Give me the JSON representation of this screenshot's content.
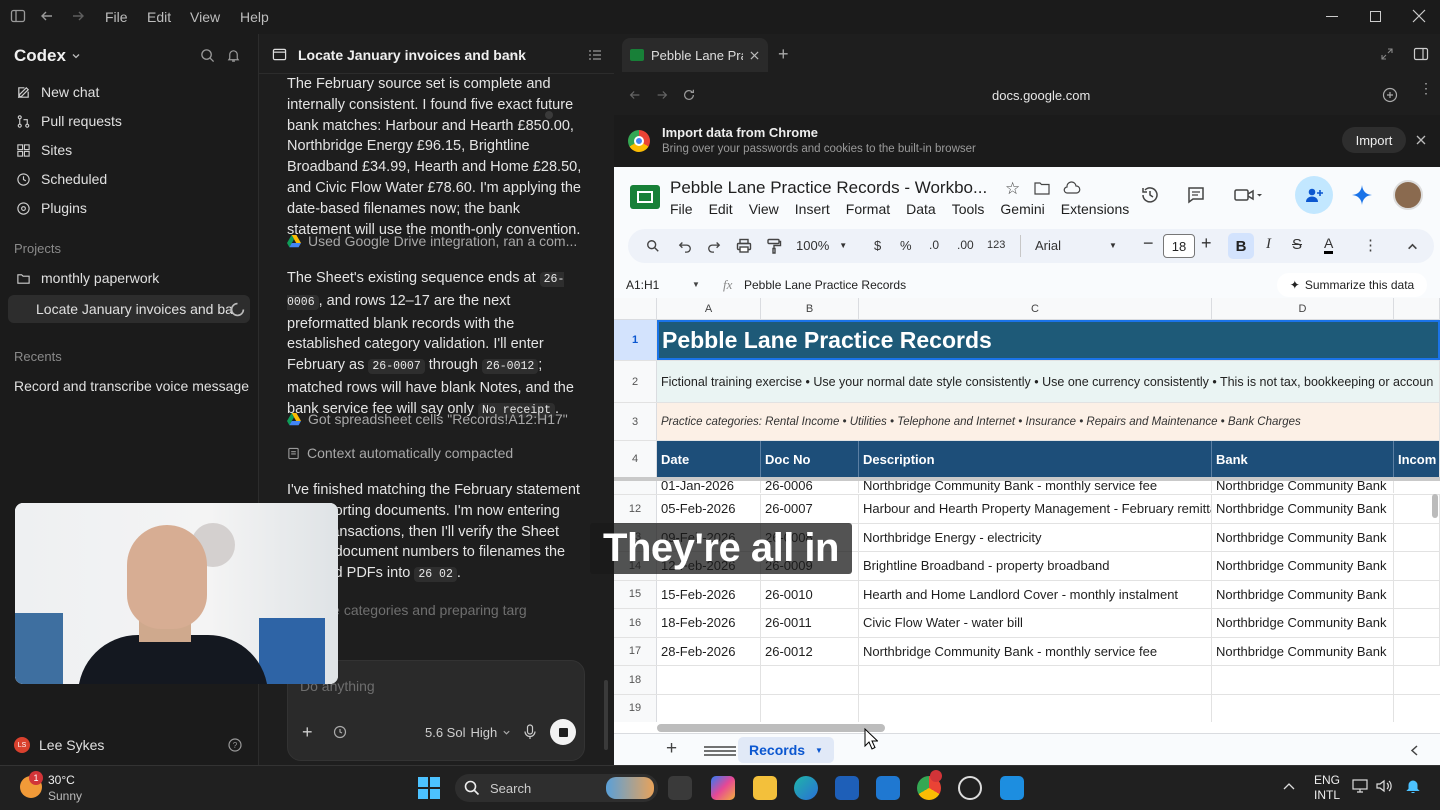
{
  "titlebar": {
    "menus": [
      "File",
      "Edit",
      "View",
      "Help"
    ]
  },
  "sidebar": {
    "brand": "Codex",
    "nav": [
      "New chat",
      "Pull requests",
      "Sites",
      "Scheduled",
      "Plugins"
    ],
    "projects_label": "Projects",
    "projects": [
      "monthly paperwork",
      "Locate January invoices and ba"
    ],
    "recents_label": "Recents",
    "recents": [
      "Record and transcribe voice message"
    ],
    "user": {
      "initials": "LS",
      "name": "Lee Sykes"
    }
  },
  "chat": {
    "title": "Locate January invoices and bank",
    "msg1": "The February source set is complete and internally consistent. I found five exact future bank matches: Harbour and Hearth £850.00, Northbridge Energy £96.15, Brightline Broadband £34.99, Hearth and Home £28.50, and Civic Flow Water £78.60. I'm applying the date-based filenames now; the bank statement will use the month-only convention.",
    "tool1": "Used Google Drive integration, ran a com...",
    "msg2_a": "The Sheet's existing sequence ends at",
    "code1": "26-0006",
    "msg2_b": ", and rows 12–17 are the next preformatted blank records with the established category validation. I'll enter February as",
    "code2": "26-0007",
    "msg2_c": "through",
    "code3": "26-0012",
    "msg2_d": "; matched rows will have blank Notes, and the bank service fee will say only",
    "code4": "No receipt",
    "msg2_e": ".",
    "tool2": "Got spreadsheet cells \"Records!A12:H17\"",
    "tool3": "Context automatically compacted",
    "msg3_a": "I've finished matching the February statement to supporting documents. I'm now entering bank transactions, then I'll verify the Sheet adding document numbers to filenames the matched PDFs into",
    "code5": "26 02",
    "msg3_b": ".",
    "status": "expense categories and preparing targ",
    "input_placeholder": "Do anything",
    "model": "5.6 Sol",
    "effort": "High"
  },
  "browser": {
    "tab_title": "Pebble Lane Prac",
    "url": "docs.google.com",
    "banner_title": "Import data from Chrome",
    "banner_text": "Bring over your passwords and cookies to the built-in browser",
    "banner_button": "Import"
  },
  "sheet": {
    "doc_title": "Pebble Lane Practice Records - Workbo...",
    "menus": [
      "File",
      "Edit",
      "View",
      "Insert",
      "Format",
      "Data",
      "Tools",
      "Gemini",
      "Extensions"
    ],
    "zoom": "100%",
    "currency": "$",
    "percent": "%",
    "dec_less": ".0",
    "dec_more": ".00",
    "number_fmt": "123",
    "font": "Arial",
    "font_size": "18",
    "cell_ref": "A1:H1",
    "formula": "Pebble Lane Practice Records",
    "summarize": "Summarize this data",
    "col_headers": [
      "A",
      "B",
      "C",
      "D"
    ],
    "title": "Pebble Lane Practice Records",
    "row2": "Fictional training exercise • Use your normal date style consistently • Use one currency consistently • This is not tax, bookkeeping or accoun",
    "row3": "Practice categories: Rental Income • Utilities • Telephone and Internet • Insurance • Repairs and Maintenance • Bank Charges",
    "headers": [
      "Date",
      "Doc No",
      "Description",
      "Bank",
      "Incom"
    ],
    "row11_partial": [
      "01-Jan-2026",
      "26-0006",
      "Northbridge Community Bank - monthly service fee",
      "Northbridge Community Bank"
    ],
    "rows": [
      {
        "n": "12",
        "date": "05-Feb-2026",
        "doc": "26-0007",
        "desc": "Harbour and Hearth Property Management - February remittance",
        "bank": "Northbridge Community Bank"
      },
      {
        "n": "13",
        "date": "09-Feb-2026",
        "doc": "26-0008",
        "desc": "Northbridge Energy - electricity",
        "bank": "Northbridge Community Bank"
      },
      {
        "n": "14",
        "date": "12-Feb-2026",
        "doc": "26-0009",
        "desc": "Brightline Broadband - property broadband",
        "bank": "Northbridge Community Bank"
      },
      {
        "n": "15",
        "date": "15-Feb-2026",
        "doc": "26-0010",
        "desc": "Hearth and Home Landlord Cover - monthly instalment",
        "bank": "Northbridge Community Bank"
      },
      {
        "n": "16",
        "date": "18-Feb-2026",
        "doc": "26-0011",
        "desc": "Civic Flow Water - water bill",
        "bank": "Northbridge Community Bank"
      },
      {
        "n": "17",
        "date": "28-Feb-2026",
        "doc": "26-0012",
        "desc": "Northbridge Community Bank - monthly service fee",
        "bank": "Northbridge Community Bank"
      }
    ],
    "empty_rows": [
      "18",
      "19"
    ],
    "sheet_tab": "Records"
  },
  "caption": "They're all in",
  "taskbar": {
    "weather_temp": "30°C",
    "weather_cond": "Sunny",
    "weather_badge": "1",
    "search": "Search",
    "lang1": "ENG",
    "lang2": "INTL"
  },
  "colors": {
    "sheet_header_blue": "#1d4e79",
    "title_teal": "#1e5a78",
    "gemini_blue": "#1a73e8"
  }
}
